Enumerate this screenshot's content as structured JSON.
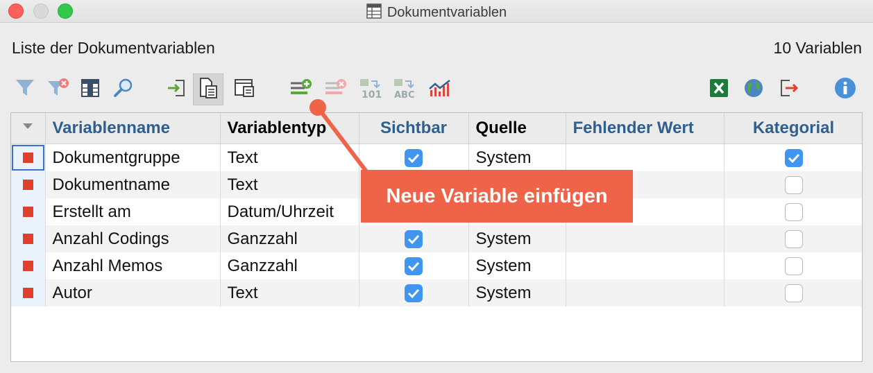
{
  "window": {
    "title": "Dokumentvariablen"
  },
  "header": {
    "list_label": "Liste der Dokumentvariablen",
    "count_label": "10 Variablen"
  },
  "table": {
    "columns": [
      "Variablenname",
      "Variablentyp",
      "Sichtbar",
      "Quelle",
      "Fehlender Wert",
      "Kategorial"
    ],
    "rows": [
      {
        "name": "Dokumentgruppe",
        "type": "Text",
        "visible": true,
        "source": "System",
        "missing": "",
        "categorical": true
      },
      {
        "name": "Dokumentname",
        "type": "Text",
        "visible": null,
        "source": "",
        "missing": "",
        "categorical": false
      },
      {
        "name": "Erstellt am",
        "type": "Datum/Uhrzeit",
        "visible": null,
        "source": "",
        "missing": "",
        "categorical": false
      },
      {
        "name": "Anzahl Codings",
        "type": "Ganzzahl",
        "visible": true,
        "source": "System",
        "missing": "",
        "categorical": false
      },
      {
        "name": "Anzahl Memos",
        "type": "Ganzzahl",
        "visible": true,
        "source": "System",
        "missing": "",
        "categorical": false
      },
      {
        "name": "Autor",
        "type": "Text",
        "visible": true,
        "source": "System",
        "missing": "",
        "categorical": false
      }
    ]
  },
  "callout": {
    "text": "Neue Variable einfügen",
    "color": "#ef6349"
  },
  "toolbar_icons": [
    "filter-icon",
    "clear-filter-icon",
    "columns-icon",
    "search-icon",
    "import-icon",
    "document-table-icon",
    "document-window-icon",
    "add-variable-icon",
    "delete-variable-icon",
    "convert-numeric-icon",
    "convert-text-icon",
    "statistics-icon",
    "excel-icon",
    "web-export-icon",
    "export-icon",
    "info-icon"
  ]
}
